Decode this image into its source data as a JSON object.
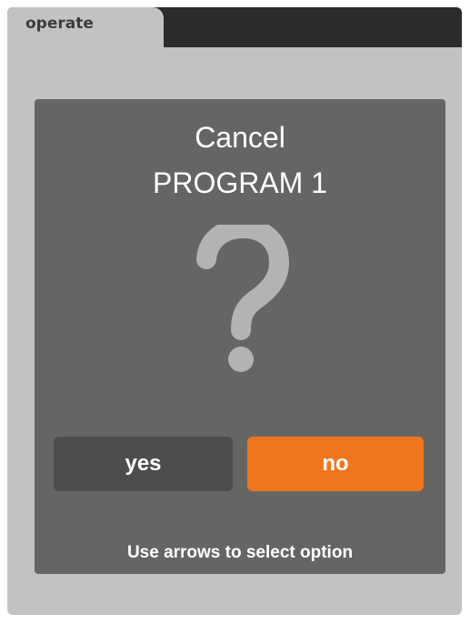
{
  "tab": {
    "label": "operate"
  },
  "dialog": {
    "title_line1": "Cancel",
    "title_line2": "PROGRAM 1",
    "icon": "question-mark-icon",
    "yes_label": "yes",
    "no_label": "no",
    "hint": "Use arrows to select option"
  },
  "colors": {
    "frame_bg": "#c2c3c1",
    "tab_strip": "#2c2a2d",
    "panel_bg": "#656664",
    "yes_button": "#4d4e4c",
    "no_button_selected": "#f0761d",
    "question_mark": "#b3b2b5"
  }
}
